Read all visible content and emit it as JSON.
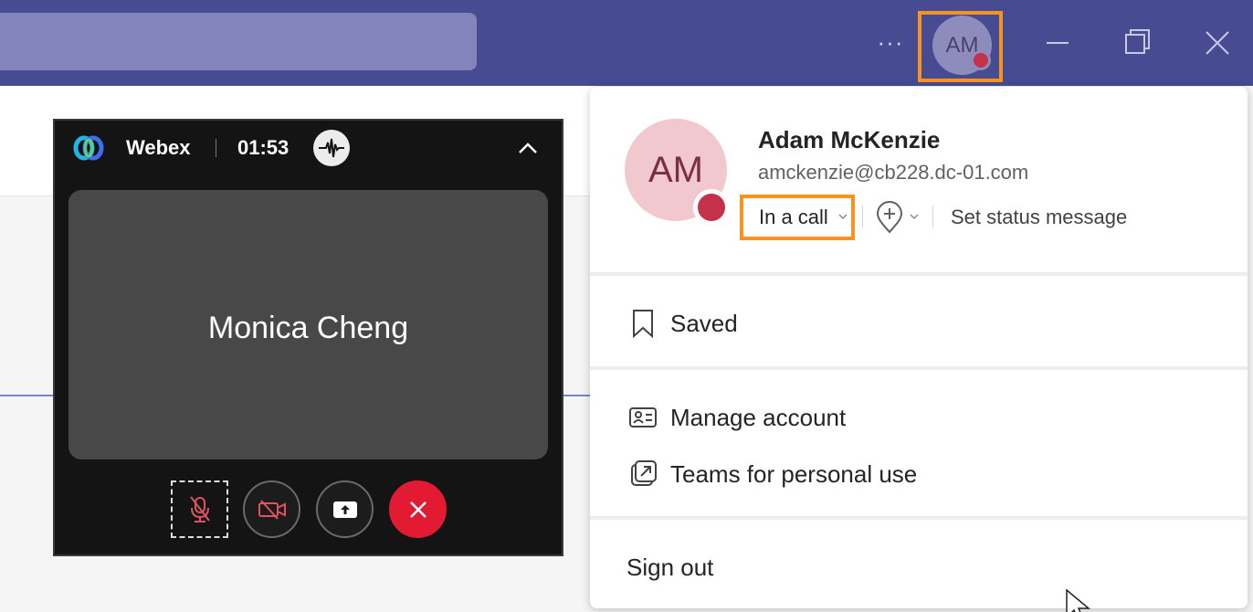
{
  "titlebar": {
    "more_label": "···",
    "avatar_initials": "AM",
    "presence_color": "#c4314b",
    "highlight_color": "#f7931e",
    "window_controls": [
      "minimize-icon",
      "restore-icon",
      "close-icon"
    ]
  },
  "webex": {
    "app_name": "Webex",
    "timer": "01:53",
    "participant": "Monica Cheng",
    "controls": [
      "mute-icon",
      "video-off-icon",
      "share-icon",
      "end-call-icon"
    ]
  },
  "profile": {
    "initials": "AM",
    "name": "Adam McKenzie",
    "email": "amckenzie@cb228.dc-01.com",
    "status": "In a call",
    "set_status": "Set status message",
    "menu": {
      "saved": "Saved",
      "manage_account": "Manage account",
      "personal_use": "Teams for personal use",
      "sign_out": "Sign out"
    }
  }
}
